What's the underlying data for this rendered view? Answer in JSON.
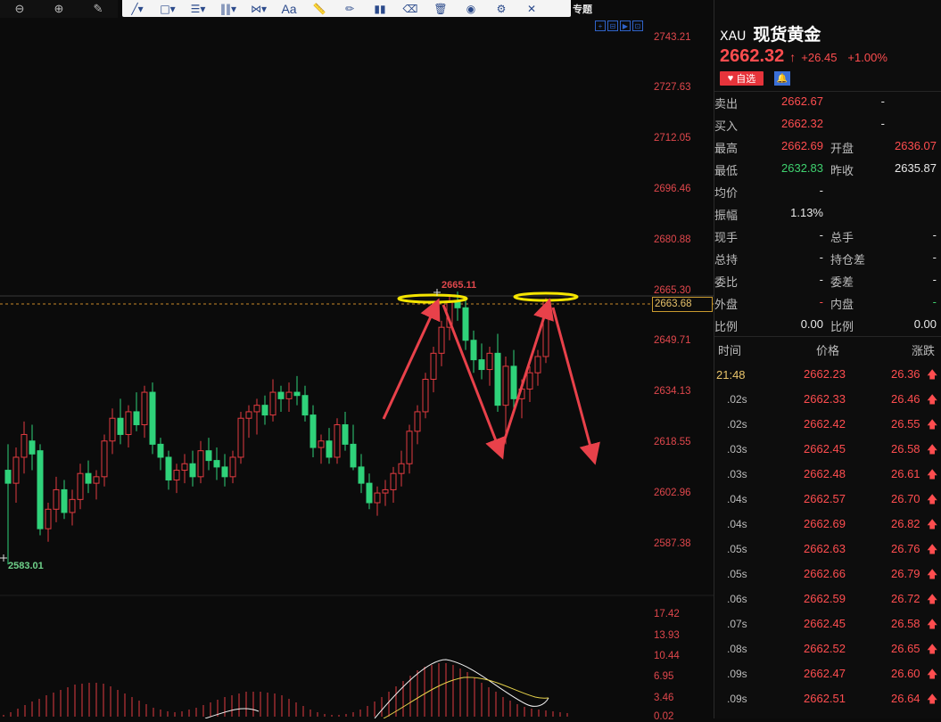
{
  "toolbar": {
    "zoom_out_icon": "zoom-out-icon",
    "zoom_in_icon": "zoom-in-icon",
    "pen_icon": "pen-icon",
    "text_tool_label": "Aa",
    "special_label": "专题"
  },
  "chart": {
    "price_axis": [
      "2743.21",
      "2727.63",
      "2712.05",
      "2696.46",
      "2680.88",
      "2665.30",
      "2649.71",
      "2634.13",
      "2618.55",
      "2602.96",
      "2587.38"
    ],
    "last_price_tag": "2663.68",
    "high_annotation": "2665.11",
    "low_annotation": "2583.01",
    "macd_axis": [
      "17.42",
      "13.93",
      "10.44",
      "6.95",
      "3.46",
      "0.02"
    ],
    "colors": {
      "up": "#e23b40",
      "down": "#2fd27a",
      "arrow": "#e8414a",
      "ellipse": "#f5e500"
    },
    "chart_data": {
      "type": "candlestick",
      "ylim": [
        2583.01,
        2743.21
      ],
      "candles": [
        [
          2610,
          2618,
          2581,
          2606
        ],
        [
          2606,
          2617,
          2600,
          2614
        ],
        [
          2614,
          2625,
          2609,
          2621
        ],
        [
          2619,
          2624,
          2610,
          2615
        ],
        [
          2616,
          2618,
          2590,
          2592
        ],
        [
          2592,
          2600,
          2588,
          2598
        ],
        [
          2598,
          2608,
          2594,
          2604
        ],
        [
          2604,
          2607,
          2595,
          2597
        ],
        [
          2597,
          2604,
          2593,
          2601
        ],
        [
          2601,
          2612,
          2598,
          2609
        ],
        [
          2609,
          2613,
          2603,
          2606
        ],
        [
          2606,
          2610,
          2601,
          2608
        ],
        [
          2608,
          2621,
          2605,
          2619
        ],
        [
          2619,
          2629,
          2615,
          2626
        ],
        [
          2626,
          2632,
          2618,
          2621
        ],
        [
          2621,
          2630,
          2617,
          2628
        ],
        [
          2628,
          2634,
          2622,
          2624
        ],
        [
          2624,
          2636,
          2620,
          2634
        ],
        [
          2634,
          2637,
          2615,
          2618
        ],
        [
          2618,
          2620,
          2610,
          2614
        ],
        [
          2614,
          2616,
          2604,
          2607
        ],
        [
          2607,
          2612,
          2603,
          2610
        ],
        [
          2610,
          2615,
          2606,
          2612
        ],
        [
          2612,
          2616,
          2605,
          2608
        ],
        [
          2608,
          2619,
          2606,
          2616
        ],
        [
          2616,
          2620,
          2610,
          2613
        ],
        [
          2613,
          2617,
          2607,
          2611
        ],
        [
          2611,
          2615,
          2605,
          2608
        ],
        [
          2608,
          2616,
          2606,
          2614
        ],
        [
          2614,
          2628,
          2612,
          2626
        ],
        [
          2626,
          2630,
          2620,
          2628
        ],
        [
          2628,
          2632,
          2621,
          2630
        ],
        [
          2630,
          2633,
          2624,
          2627
        ],
        [
          2627,
          2638,
          2625,
          2634
        ],
        [
          2634,
          2636,
          2628,
          2632
        ],
        [
          2632,
          2637,
          2628,
          2634
        ],
        [
          2634,
          2639,
          2630,
          2633
        ],
        [
          2633,
          2636,
          2625,
          2627
        ],
        [
          2627,
          2630,
          2614,
          2617
        ],
        [
          2617,
          2621,
          2612,
          2619
        ],
        [
          2619,
          2623,
          2612,
          2614
        ],
        [
          2614,
          2626,
          2612,
          2624
        ],
        [
          2624,
          2628,
          2616,
          2618
        ],
        [
          2618,
          2624,
          2610,
          2611
        ],
        [
          2611,
          2615,
          2603,
          2606
        ],
        [
          2606,
          2609,
          2598,
          2600
        ],
        [
          2600,
          2605,
          2596,
          2603
        ],
        [
          2603,
          2607,
          2599,
          2604
        ],
        [
          2604,
          2611,
          2600,
          2609
        ],
        [
          2609,
          2616,
          2605,
          2612
        ],
        [
          2612,
          2624,
          2609,
          2622
        ],
        [
          2622,
          2630,
          2618,
          2628
        ],
        [
          2628,
          2640,
          2626,
          2638
        ],
        [
          2638,
          2648,
          2634,
          2646
        ],
        [
          2646,
          2656,
          2642,
          2654
        ],
        [
          2654,
          2664,
          2650,
          2662
        ],
        [
          2662,
          2665,
          2656,
          2660
        ],
        [
          2660,
          2663,
          2647,
          2650
        ],
        [
          2650,
          2653,
          2640,
          2644
        ],
        [
          2644,
          2649,
          2638,
          2641
        ],
        [
          2641,
          2648,
          2636,
          2646
        ],
        [
          2646,
          2652,
          2628,
          2630
        ],
        [
          2630,
          2645,
          2618,
          2642
        ],
        [
          2642,
          2647,
          2628,
          2632
        ],
        [
          2632,
          2638,
          2626,
          2635
        ],
        [
          2635,
          2642,
          2631,
          2640
        ],
        [
          2640,
          2647,
          2636,
          2645
        ],
        [
          2645,
          2663,
          2643,
          2662
        ]
      ]
    }
  },
  "quote": {
    "symbol_code": "XAU",
    "symbol_name": "现货黄金",
    "price": "2662.32",
    "change": "+26.45",
    "change_pct": "+1.00%",
    "fav_label": "自选",
    "rows": [
      {
        "l1": "卖出",
        "v1": "2662.67",
        "c1": "red",
        "l2": "",
        "v2": "-",
        "c2": "white"
      },
      {
        "l1": "买入",
        "v1": "2662.32",
        "c1": "red",
        "l2": "",
        "v2": "-",
        "c2": "white"
      },
      {
        "l1": "最高",
        "v1": "2662.69",
        "c1": "red",
        "l2": "开盘",
        "v2": "2636.07",
        "c2": "red"
      },
      {
        "l1": "最低",
        "v1": "2632.83",
        "c1": "green",
        "l2": "昨收",
        "v2": "2635.87",
        "c2": "white"
      },
      {
        "l1": "均价",
        "v1": "-",
        "c1": "white",
        "l2": "",
        "v2": "",
        "c2": "white"
      },
      {
        "l1": "振幅",
        "v1": "1.13%",
        "c1": "white",
        "l2": "",
        "v2": "",
        "c2": "white"
      },
      {
        "l1": "现手",
        "v1": "-",
        "c1": "white",
        "l2": "总手",
        "v2": "-",
        "c2": "white"
      },
      {
        "l1": "总持",
        "v1": "-",
        "c1": "white",
        "l2": "持仓差",
        "v2": "-",
        "c2": "white"
      },
      {
        "l1": "委比",
        "v1": "-",
        "c1": "white",
        "l2": "委差",
        "v2": "-",
        "c2": "white"
      },
      {
        "l1": "外盘",
        "v1": "-",
        "c1": "red",
        "l2": "内盘",
        "v2": "-",
        "c2": "green"
      },
      {
        "l1": "比例",
        "v1": "0.00",
        "c1": "white",
        "l2": "比例",
        "v2": "0.00",
        "c2": "white"
      }
    ],
    "tick_header": {
      "time": "时间",
      "price": "价格",
      "change": "涨跌"
    },
    "ticks": [
      {
        "time": "21:48",
        "price": "2662.23",
        "change": "26.36"
      },
      {
        "time": ".02s",
        "price": "2662.33",
        "change": "26.46"
      },
      {
        "time": ".02s",
        "price": "2662.42",
        "change": "26.55"
      },
      {
        "time": ".03s",
        "price": "2662.45",
        "change": "26.58"
      },
      {
        "time": ".03s",
        "price": "2662.48",
        "change": "26.61"
      },
      {
        "time": ".04s",
        "price": "2662.57",
        "change": "26.70"
      },
      {
        "time": ".04s",
        "price": "2662.69",
        "change": "26.82"
      },
      {
        "time": ".05s",
        "price": "2662.63",
        "change": "26.76"
      },
      {
        "time": ".05s",
        "price": "2662.66",
        "change": "26.79"
      },
      {
        "time": ".06s",
        "price": "2662.59",
        "change": "26.72"
      },
      {
        "time": ".07s",
        "price": "2662.45",
        "change": "26.58"
      },
      {
        "time": ".08s",
        "price": "2662.52",
        "change": "26.65"
      },
      {
        "time": ".09s",
        "price": "2662.47",
        "change": "26.60"
      },
      {
        "time": ".09s",
        "price": "2662.51",
        "change": "26.64"
      }
    ]
  }
}
